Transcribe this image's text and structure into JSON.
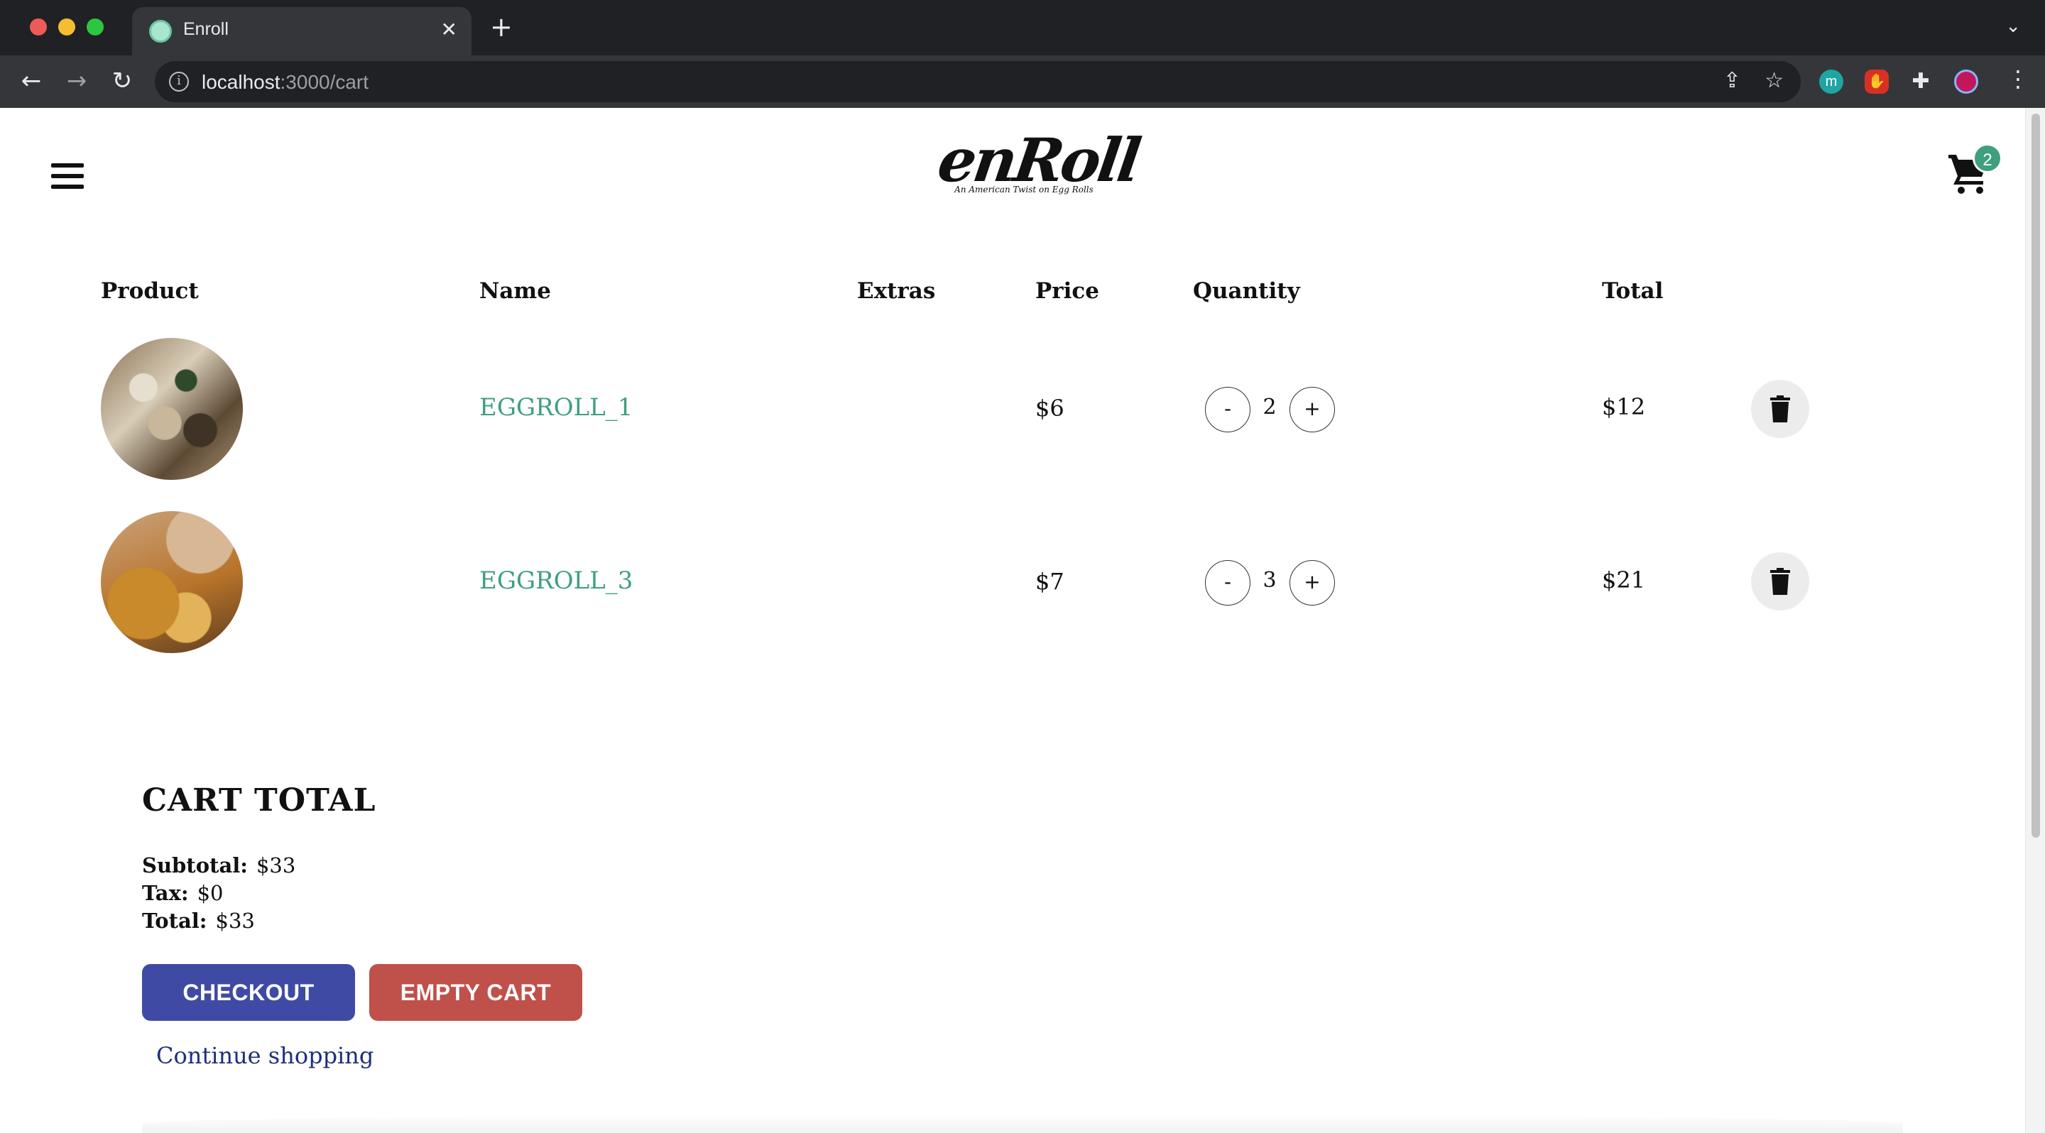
{
  "browser": {
    "tab_title": "Enroll",
    "tab_close": "✕",
    "new_tab": "+",
    "url_host": "localhost",
    "url_path": ":3000/cart",
    "extension_m": "m"
  },
  "header": {
    "logo_text": "enRoll",
    "logo_tagline": "An American Twist on Egg Rolls",
    "cart_count": "2"
  },
  "table": {
    "headers": [
      "Product",
      "Name",
      "Extras",
      "Price",
      "Quantity",
      "Total"
    ],
    "rows": [
      {
        "name": "EGGROLL_1",
        "extras": "",
        "price": "$6",
        "quantity": "2",
        "total": "$12"
      },
      {
        "name": "EGGROLL_3",
        "extras": "",
        "price": "$7",
        "quantity": "3",
        "total": "$21"
      }
    ],
    "minus_label": "-",
    "plus_label": "+"
  },
  "summary": {
    "title": "CART TOTAL",
    "subtotal_label": "Subtotal:",
    "subtotal_value": "$33",
    "tax_label": "Tax:",
    "tax_value": "$0",
    "total_label": "Total:",
    "total_value": "$33"
  },
  "actions": {
    "checkout_label": "CHECKOUT",
    "empty_label": "EMPTY CART",
    "continue_label": "Continue shopping"
  },
  "colors": {
    "accent_green": "#3f9f7f",
    "checkout_blue": "#3f4aa4",
    "empty_red": "#c0504a",
    "link_navy": "#1d2f7a"
  },
  "icons": [
    "menu-icon",
    "cart-icon",
    "trash-icon",
    "back-icon",
    "forward-icon",
    "reload-icon",
    "info-icon",
    "share-icon",
    "star-icon",
    "puzzle-icon",
    "kebab-icon"
  ]
}
